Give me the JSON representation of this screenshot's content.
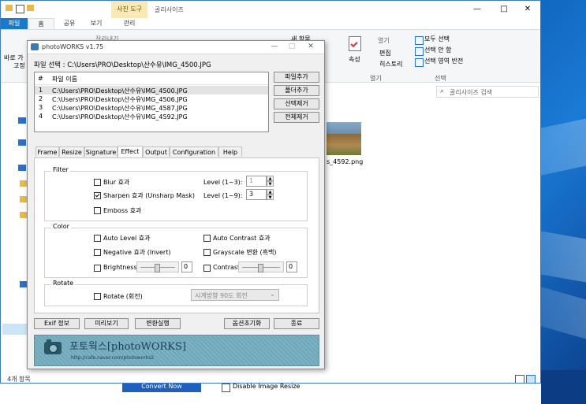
{
  "explorer": {
    "title": "골리사이즈",
    "context_tab": "사진 도구",
    "tabs": [
      "파일",
      "홈",
      "공유",
      "보기",
      "관리"
    ],
    "ribbon_left_partial": [
      "바로 가",
      "고정"
    ],
    "clipboard_partial": "잘라내기",
    "new_folder_partial": "새 항목",
    "open_group": {
      "open": "열기",
      "edit": "편집",
      "history": "히스토리",
      "label": "열기"
    },
    "properties": "속성",
    "select_group": {
      "all": "모두 선택",
      "none": "선택 안 함",
      "invert": "선택 영역 반전",
      "label": "선택"
    },
    "search_placeholder": "골리사이즈 검색",
    "file_partial": "s_4592.png",
    "status": "4개 항목"
  },
  "pw": {
    "title": "photoWORKS v1.75",
    "selected_file": "파일 선택 : C:\\Users\\PRO\\Desktop\\산수유\\IMG_4500.JPG",
    "list_headers": {
      "num": "#",
      "name": "파일 이름"
    },
    "files": [
      {
        "num": "1",
        "name": "C:\\Users\\PRO\\Desktop\\산수유\\IMG_4500.JPG"
      },
      {
        "num": "2",
        "name": "C:\\Users\\PRO\\Desktop\\산수유\\IMG_4506.JPG"
      },
      {
        "num": "3",
        "name": "C:\\Users\\PRO\\Desktop\\산수유\\IMG_4587.JPG"
      },
      {
        "num": "4",
        "name": "C:\\Users\\PRO\\Desktop\\산수유\\IMG_4592.JPG"
      }
    ],
    "side_buttons": {
      "add_file": "파일추가",
      "add_folder": "폴더추가",
      "remove_sel": "선택제거",
      "remove_all": "전체제거"
    },
    "tabs": [
      "Frame",
      "Resize",
      "Signature",
      "Effect",
      "Output",
      "Configuration",
      "Help"
    ],
    "filter": {
      "title": "Filter",
      "blur": "Blur 효과",
      "sharpen": "Sharpen 효과 (Unsharp Mask)",
      "emboss": "Emboss 효과",
      "level13_label": "Level (1~3):",
      "level13_value": "1",
      "level19_label": "Level (1~9):",
      "level19_value": "3"
    },
    "color": {
      "title": "Color",
      "auto_level": "Auto Level 효과",
      "auto_contrast": "Auto Contrast 효과",
      "negative": "Negative 효과 (Invert)",
      "grayscale": "Grayscale 변환 (흑백)",
      "brightness": "Brightness",
      "brightness_value": "0",
      "contrast": "Contrast",
      "contrast_value": "0"
    },
    "rotate": {
      "title": "Rotate",
      "label": "Rotate (회전)",
      "select": "시계방향 90도 회전"
    },
    "bottom_buttons": {
      "exif": "Exif 정보",
      "preview": "미리보기",
      "convert": "변환실행",
      "reset": "옵션초기화",
      "exit": "종료"
    },
    "banner": {
      "title": "포토웍스[photoWORKS]",
      "url": "http://cafe.naver.com/photoworks2"
    }
  },
  "background_app": {
    "convert": "Convert Now",
    "disable": "Disable Image Resize"
  }
}
